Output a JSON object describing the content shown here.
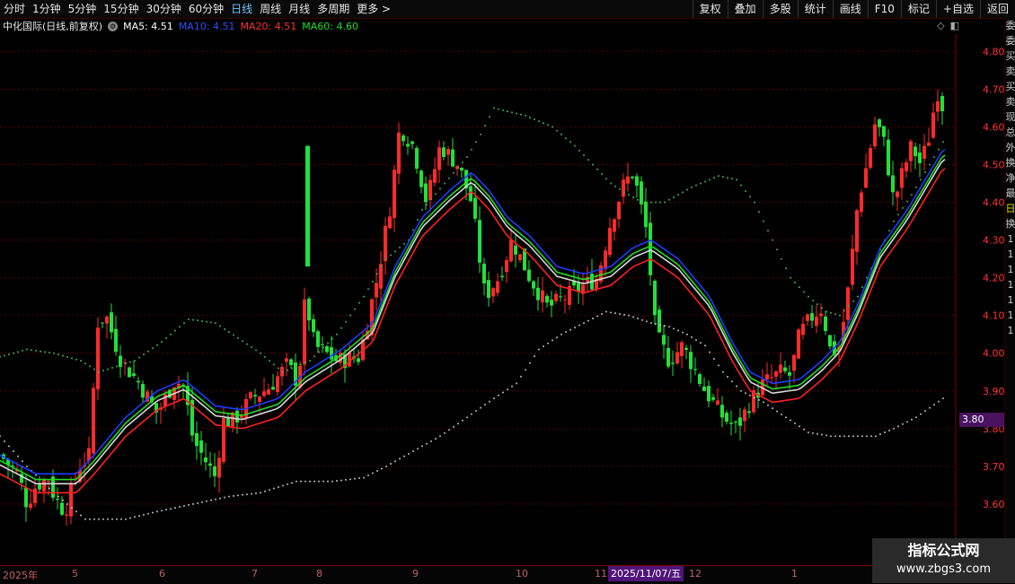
{
  "toolbar": {
    "periods": [
      "分时",
      "1分钟",
      "5分钟",
      "15分钟",
      "30分钟",
      "60分钟",
      "日线",
      "周线",
      "月线",
      "多周期",
      "更多 >"
    ],
    "active": "日线",
    "right_buttons": [
      "复权",
      "叠加",
      "多股",
      "统计",
      "画线",
      "F10",
      "标记",
      "+自选",
      "返回"
    ]
  },
  "info": {
    "title": "中化国际(日线,前复权)",
    "ma5": "MA5: 4.51",
    "ma10": "MA10: 4.51",
    "ma20": "MA20: 4.51",
    "ma60": "MA60: 4.60"
  },
  "colors": {
    "up": "#ff2a2a",
    "down": "#22e03a",
    "ma5": "#ffffff",
    "ma10": "#1e3cff",
    "ma20": "#ff2020",
    "ma60": "#22dd22",
    "band": "#bbbbbb",
    "axis": "#ff3333",
    "grid": "#5a0000"
  },
  "axis": {
    "price_labels": [
      "4.80",
      "4.70",
      "4.60",
      "4.50",
      "4.40",
      "4.30",
      "4.20",
      "4.10",
      "4.00",
      "3.90",
      "3.80",
      "3.70",
      "3.60"
    ]
  },
  "price_tag": "3.80",
  "dates": {
    "ticks": [
      {
        "label": "2025年"
      },
      {
        "label": "5"
      },
      {
        "label": "6"
      },
      {
        "label": "7"
      },
      {
        "label": "8"
      },
      {
        "label": "9"
      },
      {
        "label": "10"
      },
      {
        "label": "11"
      },
      {
        "label": "12"
      },
      {
        "label": "1"
      }
    ],
    "cursor": "2025/11/07/五"
  },
  "right_panel": [
    "委",
    "委",
    "买",
    "卖",
    "买",
    "卖",
    "现",
    "总",
    "外",
    "换",
    "净",
    "最",
    "日",
    "换",
    "1",
    "1",
    "1",
    "1",
    "1",
    "1",
    "1"
  ],
  "watermark": {
    "line1": "指标公式网",
    "line2": "www.zbgs3.com"
  },
  "chart_data": {
    "type": "candlestick",
    "ylim": [
      3.55,
      4.85
    ],
    "keyframes": [
      [
        0,
        3.73
      ],
      [
        20,
        3.68
      ],
      [
        30,
        3.6
      ],
      [
        40,
        3.65
      ],
      [
        55,
        3.67
      ],
      [
        60,
        3.62
      ],
      [
        72,
        3.58
      ],
      [
        88,
        3.7
      ],
      [
        100,
        3.73
      ],
      [
        108,
        4.08
      ],
      [
        118,
        4.1
      ],
      [
        135,
        3.98
      ],
      [
        155,
        3.92
      ],
      [
        175,
        3.84
      ],
      [
        195,
        3.93
      ],
      [
        205,
        3.91
      ],
      [
        215,
        3.77
      ],
      [
        240,
        3.67
      ],
      [
        248,
        3.82
      ],
      [
        260,
        3.82
      ],
      [
        280,
        3.88
      ],
      [
        300,
        3.91
      ],
      [
        320,
        3.97
      ],
      [
        332,
        3.92
      ],
      [
        340,
        4.15
      ],
      [
        350,
        4.02
      ],
      [
        375,
        3.98
      ],
      [
        400,
        3.99
      ],
      [
        420,
        4.2
      ],
      [
        435,
        4.4
      ],
      [
        445,
        4.6
      ],
      [
        460,
        4.55
      ],
      [
        475,
        4.4
      ],
      [
        490,
        4.55
      ],
      [
        510,
        4.5
      ],
      [
        525,
        4.4
      ],
      [
        540,
        4.15
      ],
      [
        555,
        4.2
      ],
      [
        570,
        4.3
      ],
      [
        590,
        4.2
      ],
      [
        610,
        4.12
      ],
      [
        630,
        4.15
      ],
      [
        650,
        4.18
      ],
      [
        665,
        4.2
      ],
      [
        680,
        4.35
      ],
      [
        695,
        4.45
      ],
      [
        705,
        4.48
      ],
      [
        720,
        4.32
      ],
      [
        730,
        4.05
      ],
      [
        745,
        3.98
      ],
      [
        760,
        4.02
      ],
      [
        785,
        3.9
      ],
      [
        805,
        3.83
      ],
      [
        820,
        3.8
      ],
      [
        835,
        3.87
      ],
      [
        850,
        3.92
      ],
      [
        870,
        3.95
      ],
      [
        880,
        3.94
      ],
      [
        890,
        4.05
      ],
      [
        905,
        4.1
      ],
      [
        915,
        4.12
      ],
      [
        925,
        4.0
      ],
      [
        935,
        4.02
      ],
      [
        945,
        4.18
      ],
      [
        955,
        4.4
      ],
      [
        965,
        4.5
      ],
      [
        975,
        4.62
      ],
      [
        985,
        4.55
      ],
      [
        995,
        4.4
      ],
      [
        1005,
        4.48
      ],
      [
        1015,
        4.55
      ],
      [
        1025,
        4.5
      ],
      [
        1035,
        4.58
      ],
      [
        1043,
        4.7
      ],
      [
        1050,
        4.65
      ]
    ],
    "ma20_keyframes": [
      [
        0,
        3.7
      ],
      [
        40,
        3.65
      ],
      [
        85,
        3.65
      ],
      [
        105,
        3.7
      ],
      [
        140,
        3.8
      ],
      [
        175,
        3.87
      ],
      [
        205,
        3.9
      ],
      [
        240,
        3.83
      ],
      [
        270,
        3.82
      ],
      [
        310,
        3.85
      ],
      [
        340,
        3.92
      ],
      [
        380,
        3.98
      ],
      [
        415,
        4.05
      ],
      [
        440,
        4.2
      ],
      [
        470,
        4.33
      ],
      [
        500,
        4.4
      ],
      [
        525,
        4.45
      ],
      [
        545,
        4.4
      ],
      [
        565,
        4.33
      ],
      [
        590,
        4.28
      ],
      [
        620,
        4.2
      ],
      [
        650,
        4.18
      ],
      [
        680,
        4.2
      ],
      [
        705,
        4.25
      ],
      [
        725,
        4.27
      ],
      [
        755,
        4.22
      ],
      [
        790,
        4.12
      ],
      [
        815,
        4.0
      ],
      [
        835,
        3.92
      ],
      [
        860,
        3.89
      ],
      [
        890,
        3.9
      ],
      [
        915,
        3.95
      ],
      [
        935,
        4.0
      ],
      [
        955,
        4.1
      ],
      [
        980,
        4.25
      ],
      [
        1010,
        4.35
      ],
      [
        1035,
        4.45
      ],
      [
        1050,
        4.51
      ]
    ],
    "ma_offsets": {
      "ma5": 0.004,
      "ma60": 0.015,
      "ma10": 0.03
    },
    "upper_band_keyframes": [
      [
        0,
        3.99
      ],
      [
        30,
        4.01
      ],
      [
        60,
        4.0
      ],
      [
        90,
        3.98
      ],
      [
        110,
        3.95
      ],
      [
        150,
        3.98
      ],
      [
        180,
        4.03
      ],
      [
        210,
        4.09
      ],
      [
        240,
        4.08
      ],
      [
        265,
        4.04
      ],
      [
        290,
        4.0
      ],
      [
        315,
        3.95
      ],
      [
        345,
        3.98
      ],
      [
        375,
        4.05
      ],
      [
        405,
        4.15
      ],
      [
        430,
        4.25
      ],
      [
        455,
        4.3
      ],
      [
        470,
        4.38
      ],
      [
        495,
        4.45
      ],
      [
        520,
        4.52
      ],
      [
        535,
        4.58
      ],
      [
        550,
        4.65
      ],
      [
        585,
        4.63
      ],
      [
        615,
        4.6
      ],
      [
        640,
        4.55
      ],
      [
        660,
        4.5
      ],
      [
        680,
        4.45
      ],
      [
        700,
        4.42
      ],
      [
        715,
        4.4
      ],
      [
        740,
        4.4
      ],
      [
        770,
        4.44
      ],
      [
        800,
        4.47
      ],
      [
        820,
        4.46
      ],
      [
        840,
        4.4
      ],
      [
        860,
        4.3
      ],
      [
        880,
        4.2
      ],
      [
        900,
        4.15
      ],
      [
        920,
        4.11
      ],
      [
        935,
        4.1
      ],
      [
        955,
        4.15
      ],
      [
        975,
        4.25
      ],
      [
        995,
        4.35
      ],
      [
        1015,
        4.42
      ],
      [
        1035,
        4.5
      ],
      [
        1050,
        4.56
      ]
    ],
    "lower_band_keyframes": [
      [
        0,
        3.78
      ],
      [
        30,
        3.7
      ],
      [
        60,
        3.63
      ],
      [
        85,
        3.58
      ],
      [
        95,
        3.56
      ],
      [
        140,
        3.56
      ],
      [
        175,
        3.58
      ],
      [
        215,
        3.6
      ],
      [
        255,
        3.62
      ],
      [
        290,
        3.63
      ],
      [
        330,
        3.66
      ],
      [
        370,
        3.66
      ],
      [
        405,
        3.67
      ],
      [
        430,
        3.7
      ],
      [
        460,
        3.74
      ],
      [
        490,
        3.78
      ],
      [
        520,
        3.83
      ],
      [
        550,
        3.88
      ],
      [
        575,
        3.92
      ],
      [
        600,
        4.01
      ],
      [
        625,
        4.05
      ],
      [
        650,
        4.08
      ],
      [
        675,
        4.11
      ],
      [
        700,
        4.1
      ],
      [
        725,
        4.08
      ],
      [
        745,
        4.07
      ],
      [
        765,
        4.05
      ],
      [
        785,
        4.02
      ],
      [
        805,
        3.95
      ],
      [
        825,
        3.9
      ],
      [
        850,
        3.87
      ],
      [
        875,
        3.83
      ],
      [
        900,
        3.79
      ],
      [
        925,
        3.78
      ],
      [
        950,
        3.78
      ],
      [
        975,
        3.78
      ],
      [
        995,
        3.8
      ],
      [
        1020,
        3.83
      ],
      [
        1050,
        3.88
      ]
    ]
  }
}
